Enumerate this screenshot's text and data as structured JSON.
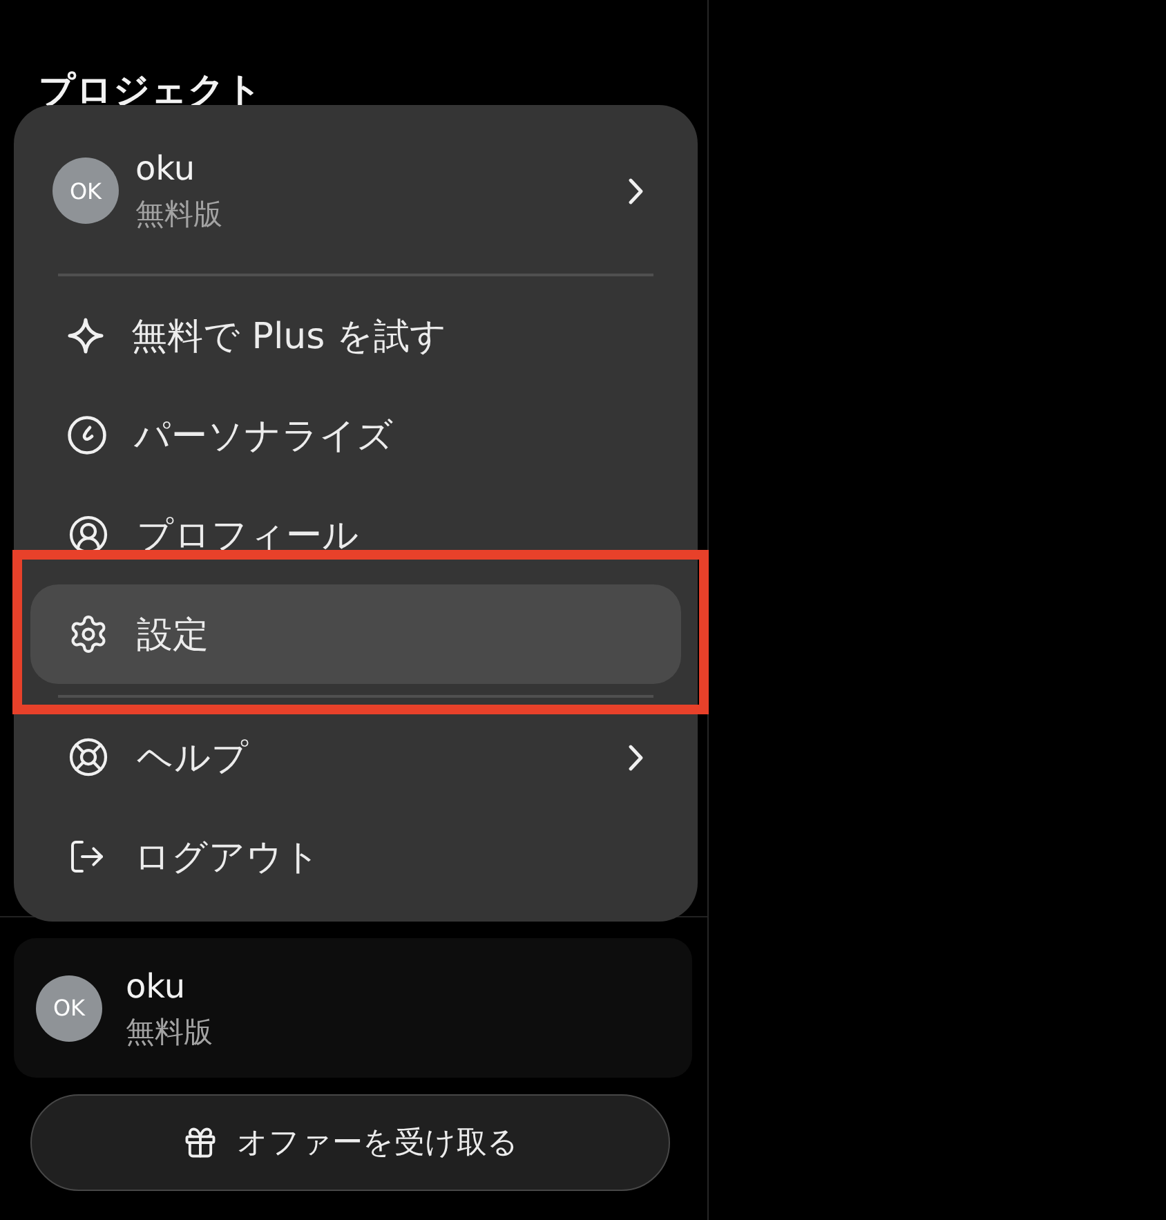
{
  "sidebar": {
    "section_heading": "プロジェクト"
  },
  "account_menu": {
    "profile": {
      "initials": "OK",
      "name": "oku",
      "plan": "無料版",
      "submenu": true
    },
    "sections": [
      {
        "items": [
          {
            "label": "無料で Plus を試す",
            "selected": false,
            "submenu": false,
            "outlined": false
          },
          {
            "label": "パーソナライズ",
            "selected": false,
            "submenu": false,
            "outlined": false
          },
          {
            "label": "プロフィール",
            "selected": false,
            "submenu": false,
            "outlined": false
          },
          {
            "label": "設定",
            "selected": true,
            "submenu": false,
            "outlined": true
          }
        ]
      },
      {
        "items": [
          {
            "label": "ヘルプ",
            "selected": false,
            "submenu": true,
            "outlined": false
          },
          {
            "label": "ログアウト",
            "selected": false,
            "submenu": false,
            "outlined": false
          }
        ]
      }
    ]
  },
  "account_card": {
    "initials": "OK",
    "name": "oku",
    "plan": "無料版"
  },
  "offer_button": {
    "label": "オファーを受け取る"
  }
}
